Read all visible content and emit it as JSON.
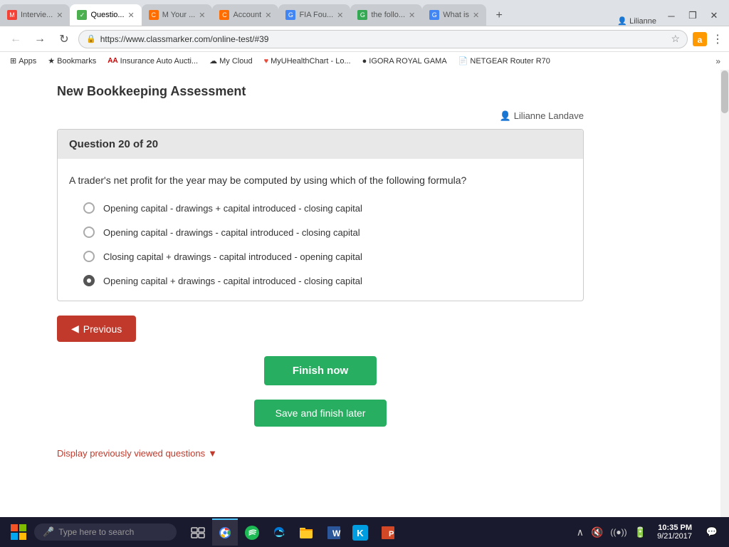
{
  "browser": {
    "tabs": [
      {
        "id": "gmail",
        "label": "Intervie...",
        "favicon_color": "#f44336",
        "active": false,
        "favicon_letter": "M"
      },
      {
        "id": "classmarker",
        "label": "Questio...",
        "favicon_color": "#4caf50",
        "active": true,
        "favicon_letter": "✓"
      },
      {
        "id": "myaccount",
        "label": "M Your ...",
        "favicon_color": "#ff6d00",
        "active": false,
        "favicon_letter": "C"
      },
      {
        "id": "account",
        "label": "Account",
        "favicon_color": "#ff6d00",
        "active": false,
        "favicon_letter": "C"
      },
      {
        "id": "fia",
        "label": "FIA Fou...",
        "favicon_color": "#4285f4",
        "active": false,
        "favicon_letter": "G"
      },
      {
        "id": "following",
        "label": "the follo...",
        "favicon_color": "#34a853",
        "active": false,
        "favicon_letter": "G"
      },
      {
        "id": "whatis",
        "label": "What is",
        "favicon_color": "#4285f4",
        "active": false,
        "favicon_letter": "G"
      }
    ],
    "url": "https://www.classmarker.com/online-test/#39",
    "user": "Lilianne"
  },
  "bookmarks": [
    {
      "label": "Apps",
      "icon": "grid"
    },
    {
      "label": "Bookmarks",
      "icon": "star"
    },
    {
      "label": "Insurance Auto Aucti...",
      "icon": "aa"
    },
    {
      "label": "My Cloud",
      "icon": "cloud"
    },
    {
      "label": "MyUHealthChart - Lo...",
      "icon": "heart"
    },
    {
      "label": "IGORA ROYAL GAMA",
      "icon": "circle"
    },
    {
      "label": "NETGEAR Router R70",
      "icon": "doc"
    }
  ],
  "page": {
    "title": "New Bookkeeping Assessment",
    "user_info": "Lilianne Landave",
    "question": {
      "number": "Question 20 of 20",
      "text": "A trader's net profit for the year may be computed by using which of the following formula?",
      "options": [
        {
          "id": "opt1",
          "text": "Opening capital - drawings + capital introduced - closing capital",
          "selected": false
        },
        {
          "id": "opt2",
          "text": "Opening capital - drawings - capital introduced - closing capital",
          "selected": false
        },
        {
          "id": "opt3",
          "text": "Closing capital + drawings - capital introduced - opening capital",
          "selected": false
        },
        {
          "id": "opt4",
          "text": "Opening capital + drawings - capital introduced - closing capital",
          "selected": true
        }
      ]
    },
    "buttons": {
      "previous": "◄ Previous",
      "previous_label": "Previous",
      "finish_now": "Finish now",
      "save_later": "Save and finish later",
      "display_previous": "Display previously viewed questions"
    }
  },
  "taskbar": {
    "search_placeholder": "Type here to search",
    "clock_time": "10:35 PM",
    "clock_date": "9/21/2017"
  }
}
